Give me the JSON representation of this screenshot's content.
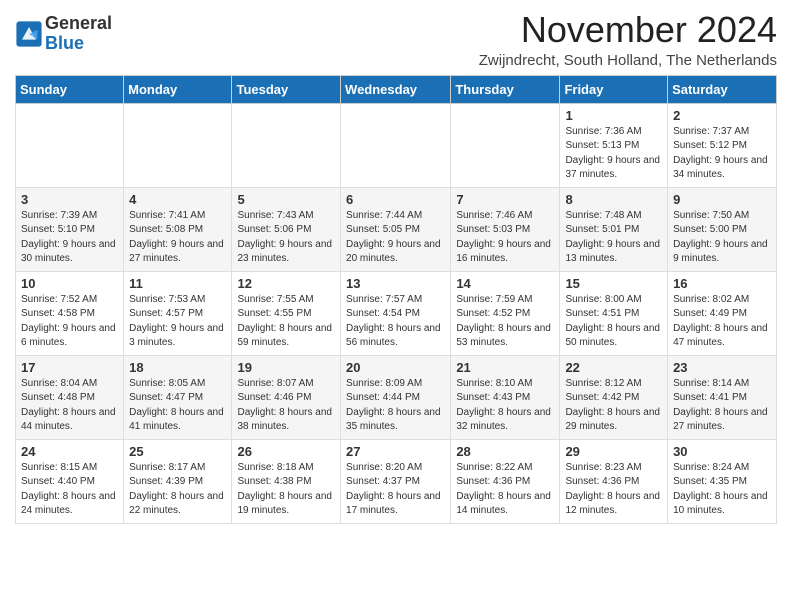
{
  "header": {
    "logo_general": "General",
    "logo_blue": "Blue",
    "month_title": "November 2024",
    "location": "Zwijndrecht, South Holland, The Netherlands"
  },
  "days_of_week": [
    "Sunday",
    "Monday",
    "Tuesday",
    "Wednesday",
    "Thursday",
    "Friday",
    "Saturday"
  ],
  "weeks": [
    [
      {
        "day": "",
        "info": ""
      },
      {
        "day": "",
        "info": ""
      },
      {
        "day": "",
        "info": ""
      },
      {
        "day": "",
        "info": ""
      },
      {
        "day": "",
        "info": ""
      },
      {
        "day": "1",
        "info": "Sunrise: 7:36 AM\nSunset: 5:13 PM\nDaylight: 9 hours and 37 minutes."
      },
      {
        "day": "2",
        "info": "Sunrise: 7:37 AM\nSunset: 5:12 PM\nDaylight: 9 hours and 34 minutes."
      }
    ],
    [
      {
        "day": "3",
        "info": "Sunrise: 7:39 AM\nSunset: 5:10 PM\nDaylight: 9 hours and 30 minutes."
      },
      {
        "day": "4",
        "info": "Sunrise: 7:41 AM\nSunset: 5:08 PM\nDaylight: 9 hours and 27 minutes."
      },
      {
        "day": "5",
        "info": "Sunrise: 7:43 AM\nSunset: 5:06 PM\nDaylight: 9 hours and 23 minutes."
      },
      {
        "day": "6",
        "info": "Sunrise: 7:44 AM\nSunset: 5:05 PM\nDaylight: 9 hours and 20 minutes."
      },
      {
        "day": "7",
        "info": "Sunrise: 7:46 AM\nSunset: 5:03 PM\nDaylight: 9 hours and 16 minutes."
      },
      {
        "day": "8",
        "info": "Sunrise: 7:48 AM\nSunset: 5:01 PM\nDaylight: 9 hours and 13 minutes."
      },
      {
        "day": "9",
        "info": "Sunrise: 7:50 AM\nSunset: 5:00 PM\nDaylight: 9 hours and 9 minutes."
      }
    ],
    [
      {
        "day": "10",
        "info": "Sunrise: 7:52 AM\nSunset: 4:58 PM\nDaylight: 9 hours and 6 minutes."
      },
      {
        "day": "11",
        "info": "Sunrise: 7:53 AM\nSunset: 4:57 PM\nDaylight: 9 hours and 3 minutes."
      },
      {
        "day": "12",
        "info": "Sunrise: 7:55 AM\nSunset: 4:55 PM\nDaylight: 8 hours and 59 minutes."
      },
      {
        "day": "13",
        "info": "Sunrise: 7:57 AM\nSunset: 4:54 PM\nDaylight: 8 hours and 56 minutes."
      },
      {
        "day": "14",
        "info": "Sunrise: 7:59 AM\nSunset: 4:52 PM\nDaylight: 8 hours and 53 minutes."
      },
      {
        "day": "15",
        "info": "Sunrise: 8:00 AM\nSunset: 4:51 PM\nDaylight: 8 hours and 50 minutes."
      },
      {
        "day": "16",
        "info": "Sunrise: 8:02 AM\nSunset: 4:49 PM\nDaylight: 8 hours and 47 minutes."
      }
    ],
    [
      {
        "day": "17",
        "info": "Sunrise: 8:04 AM\nSunset: 4:48 PM\nDaylight: 8 hours and 44 minutes."
      },
      {
        "day": "18",
        "info": "Sunrise: 8:05 AM\nSunset: 4:47 PM\nDaylight: 8 hours and 41 minutes."
      },
      {
        "day": "19",
        "info": "Sunrise: 8:07 AM\nSunset: 4:46 PM\nDaylight: 8 hours and 38 minutes."
      },
      {
        "day": "20",
        "info": "Sunrise: 8:09 AM\nSunset: 4:44 PM\nDaylight: 8 hours and 35 minutes."
      },
      {
        "day": "21",
        "info": "Sunrise: 8:10 AM\nSunset: 4:43 PM\nDaylight: 8 hours and 32 minutes."
      },
      {
        "day": "22",
        "info": "Sunrise: 8:12 AM\nSunset: 4:42 PM\nDaylight: 8 hours and 29 minutes."
      },
      {
        "day": "23",
        "info": "Sunrise: 8:14 AM\nSunset: 4:41 PM\nDaylight: 8 hours and 27 minutes."
      }
    ],
    [
      {
        "day": "24",
        "info": "Sunrise: 8:15 AM\nSunset: 4:40 PM\nDaylight: 8 hours and 24 minutes."
      },
      {
        "day": "25",
        "info": "Sunrise: 8:17 AM\nSunset: 4:39 PM\nDaylight: 8 hours and 22 minutes."
      },
      {
        "day": "26",
        "info": "Sunrise: 8:18 AM\nSunset: 4:38 PM\nDaylight: 8 hours and 19 minutes."
      },
      {
        "day": "27",
        "info": "Sunrise: 8:20 AM\nSunset: 4:37 PM\nDaylight: 8 hours and 17 minutes."
      },
      {
        "day": "28",
        "info": "Sunrise: 8:22 AM\nSunset: 4:36 PM\nDaylight: 8 hours and 14 minutes."
      },
      {
        "day": "29",
        "info": "Sunrise: 8:23 AM\nSunset: 4:36 PM\nDaylight: 8 hours and 12 minutes."
      },
      {
        "day": "30",
        "info": "Sunrise: 8:24 AM\nSunset: 4:35 PM\nDaylight: 8 hours and 10 minutes."
      }
    ]
  ]
}
